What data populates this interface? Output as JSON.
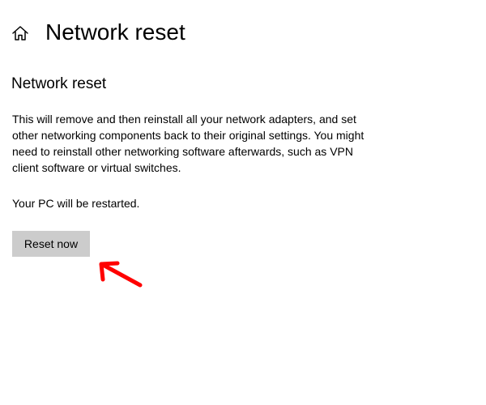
{
  "header": {
    "icon": "home-icon",
    "title": "Network reset"
  },
  "section": {
    "heading": "Network reset",
    "description": "This will remove and then reinstall all your network adapters, and set other networking components back to their original settings. You might need to reinstall other networking software afterwards, such as VPN client software or virtual switches.",
    "restart_note": "Your PC will be restarted."
  },
  "actions": {
    "reset_label": "Reset now"
  },
  "annotation": {
    "type": "arrow",
    "color": "#ff0000"
  },
  "colors": {
    "button_background": "#cccccc",
    "text": "#000000",
    "background": "#ffffff"
  }
}
